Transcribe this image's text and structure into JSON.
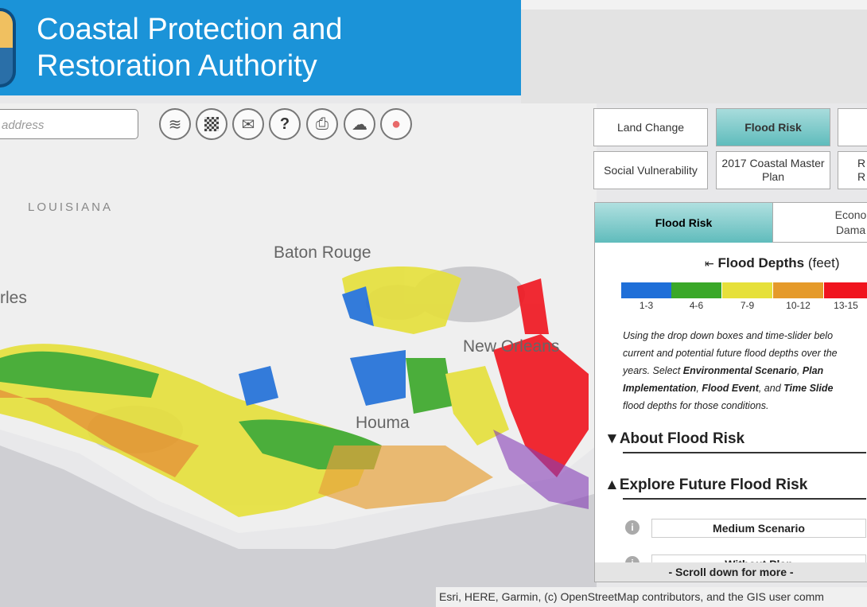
{
  "header": {
    "title_line1": "Coastal Protection and",
    "title_line2": "Restoration Authority"
  },
  "search": {
    "placeholder": "address"
  },
  "tools": [
    {
      "icon": "layers-icon"
    },
    {
      "icon": "basemap-icon"
    },
    {
      "icon": "email-icon"
    },
    {
      "icon": "help-icon",
      "glyph": "?"
    },
    {
      "icon": "print-icon"
    },
    {
      "icon": "cloud-download-icon"
    },
    {
      "icon": "location-pin-icon"
    }
  ],
  "map": {
    "labels": {
      "state": "LOUISIANA",
      "baton_rouge": "Baton Rouge",
      "lake_charles": "rles",
      "new_orleans": "New Orleans",
      "houma": "Houma"
    },
    "attribution": "Esri, HERE, Garmin, (c) OpenStreetMap contributors, and the GIS user comm"
  },
  "nav": {
    "row1": [
      "Land Change",
      "Flood Risk",
      ""
    ],
    "row2": [
      "Social Vulnerability",
      "2017 Coastal Master Plan",
      "R R"
    ],
    "active": "Flood Risk"
  },
  "panel": {
    "tabs": [
      "Flood Risk",
      "Econo Dama"
    ],
    "legend": {
      "title": "Flood Depths",
      "unit": "(feet)",
      "items": [
        {
          "label": "1-3",
          "color": "#1f6fd8"
        },
        {
          "label": "4-6",
          "color": "#3aa828"
        },
        {
          "label": "7-9",
          "color": "#e6e03a"
        },
        {
          "label": "10-12",
          "color": "#e59a2a"
        },
        {
          "label": "13-15",
          "color": "#f0141e"
        }
      ]
    },
    "description": {
      "l1": "Using the drop down boxes and time-slider belo",
      "l2": "current and potential future flood depths over the",
      "l3a": "years. Select ",
      "l3b": "Environmental Scenario",
      "l3c": ", ",
      "l3d": "Plan",
      "l4a": "Implementation",
      "l4b": ", ",
      "l4c": "Flood Event",
      "l4d": ", and ",
      "l4e": "Time Slide",
      "l5": "flood depths for those conditions."
    },
    "about": "About Flood Risk",
    "explore": "Explore Future Flood Risk",
    "scenario": "Medium Scenario",
    "plan": "Without Plan",
    "scroll": "- Scroll down for more -"
  }
}
